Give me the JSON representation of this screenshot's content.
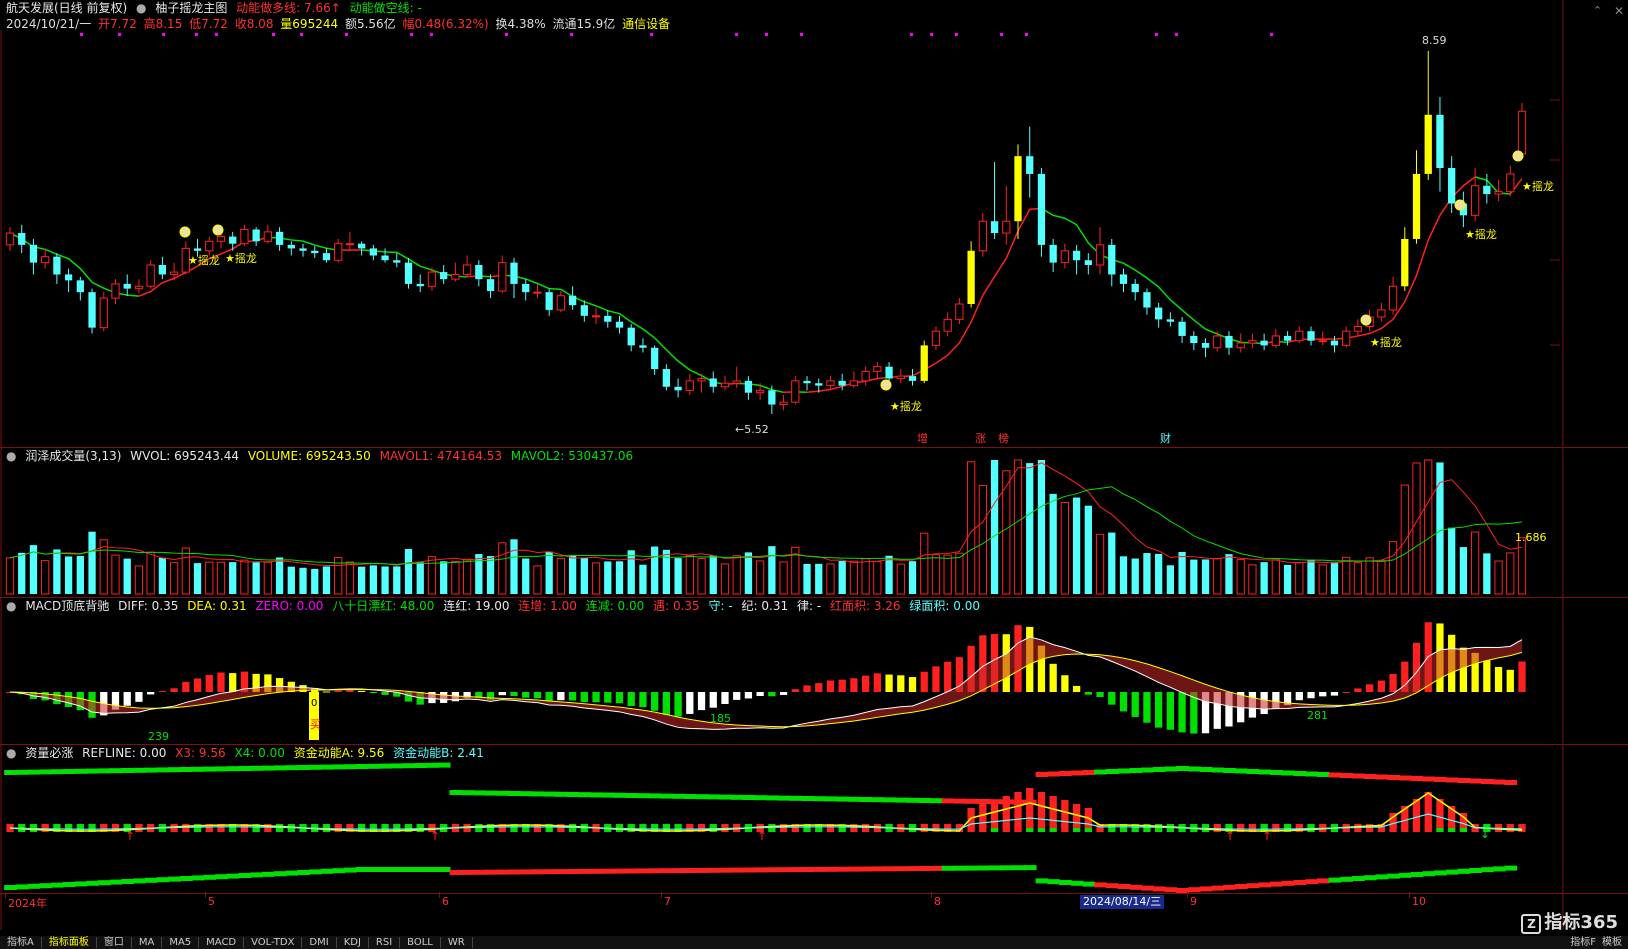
{
  "title_bar": {
    "stock": "航天发展(日线 前复权)",
    "indicator": "柚子摇龙主图",
    "line_bull_label": "动能做多线: 7.66",
    "line_bull_arrow": "↑",
    "line_bear_label": "动能做空线: -"
  },
  "quote_bar": {
    "date": "2024/10/21/一",
    "open": "开7.72",
    "high": "高8.15",
    "low": "低7.72",
    "close": "收8.08",
    "volume": "量695244",
    "amount": "额5.56亿",
    "change": "幅0.48(6.32%)",
    "turnover": "换4.38%",
    "float": "流通15.9亿",
    "sector": "通信设备"
  },
  "main_annotations": {
    "high_price": "8.59",
    "low_price": "5.52",
    "signal_label": "★摇龙",
    "tags": [
      "增",
      "涨",
      "榜",
      "财"
    ]
  },
  "vol_header": {
    "name": "润泽成交量(3,13)",
    "wvol": "WVOL: 695243.44",
    "volume": "VOLUME: 695243.50",
    "mavol1": "MAVOL1: 474164.53",
    "mavol2": "MAVOL2: 530437.06",
    "right_value": "1.686"
  },
  "macd_header": {
    "name": "MACD顶底背驰",
    "diff": "DIFF: 0.35",
    "dea": "DEA: 0.31",
    "zero": "ZERO: 0.00",
    "piao": "八十日漂红: 48.00",
    "lianhong": "连红: 19.00",
    "lianzeng": "连增: 1.00",
    "lianjian": "连减: 0.00",
    "ji": "遇: 0.35",
    "shou": "守: -",
    "ji2": "纪: 0.31",
    "lv": "律: -",
    "hongmianji": "红面积: 3.26",
    "lvmianji": "绿面积: 0.00",
    "labels": [
      "239",
      "185",
      "281"
    ],
    "buy_label": "买",
    "zero_mark": "0"
  },
  "fund_header": {
    "name": "资量必涨",
    "refline": "REFLINE: 0.00",
    "x3": "X3: 9.56",
    "x4": "X4: 0.00",
    "a": "资金动能A: 9.56",
    "b": "资金动能B: 2.41"
  },
  "time_axis": {
    "labels": [
      "2024年",
      "5",
      "6",
      "7",
      "8",
      "9",
      "10"
    ],
    "cursor_date": "2024/08/14/三"
  },
  "bottom_tabs": [
    "指标A",
    "指标面板",
    "窗口",
    "MA",
    "MA5",
    "MACD",
    "VOL-TDX",
    "DMI",
    "KDJ",
    "RSI",
    "BOLL",
    "WR"
  ],
  "bottom_right": [
    "指标F",
    "模板"
  ],
  "brand": "指标365",
  "colors": {
    "up": "#ff2020",
    "down": "#54ffff",
    "yellow": "#ffff00",
    "green": "#00e000",
    "magenta": "#ff00ff",
    "border": "#7a1010"
  },
  "chart_data": {
    "type": "candlestick",
    "price_range": [
      5.52,
      8.59
    ],
    "candles": [
      [
        6.95,
        7.05,
        7.1,
        6.9
      ],
      [
        7.05,
        6.95,
        7.12,
        6.88
      ],
      [
        6.95,
        6.8,
        7.0,
        6.7
      ],
      [
        6.8,
        6.85,
        6.92,
        6.75
      ],
      [
        6.85,
        6.7,
        6.88,
        6.62
      ],
      [
        6.7,
        6.65,
        6.75,
        6.55
      ],
      [
        6.65,
        6.55,
        6.68,
        6.48
      ],
      [
        6.55,
        6.25,
        6.58,
        6.2
      ],
      [
        6.25,
        6.5,
        6.55,
        6.22
      ],
      [
        6.5,
        6.62,
        6.66,
        6.45
      ],
      [
        6.62,
        6.58,
        6.7,
        6.52
      ],
      [
        6.58,
        6.6,
        6.66,
        6.54
      ],
      [
        6.6,
        6.78,
        6.82,
        6.58
      ],
      [
        6.78,
        6.7,
        6.85,
        6.66
      ],
      [
        6.7,
        6.72,
        6.8,
        6.65
      ],
      [
        6.72,
        6.92,
        6.98,
        6.7
      ],
      [
        6.92,
        6.9,
        7.0,
        6.85
      ],
      [
        6.9,
        6.98,
        7.02,
        6.86
      ],
      [
        6.98,
        7.02,
        7.08,
        6.92
      ],
      [
        7.02,
        6.96,
        7.06,
        6.9
      ],
      [
        6.96,
        7.08,
        7.12,
        6.94
      ],
      [
        7.08,
        6.98,
        7.1,
        6.94
      ],
      [
        6.98,
        7.06,
        7.12,
        6.96
      ],
      [
        7.06,
        6.95,
        7.1,
        6.9
      ],
      [
        6.95,
        6.92,
        6.98,
        6.86
      ],
      [
        6.92,
        6.9,
        6.96,
        6.85
      ],
      [
        6.9,
        6.88,
        6.94,
        6.84
      ],
      [
        6.88,
        6.82,
        6.92,
        6.8
      ],
      [
        6.82,
        6.96,
        7.0,
        6.8
      ],
      [
        6.96,
        6.96,
        7.06,
        6.9
      ],
      [
        6.96,
        6.92,
        6.98,
        6.86
      ],
      [
        6.92,
        6.86,
        6.95,
        6.82
      ],
      [
        6.86,
        6.82,
        6.92,
        6.8
      ],
      [
        6.82,
        6.8,
        6.88,
        6.76
      ],
      [
        6.8,
        6.62,
        6.84,
        6.58
      ],
      [
        6.62,
        6.6,
        6.7,
        6.55
      ],
      [
        6.6,
        6.72,
        6.76,
        6.56
      ],
      [
        6.72,
        6.66,
        6.78,
        6.62
      ],
      [
        6.66,
        6.7,
        6.8,
        6.64
      ],
      [
        6.7,
        6.78,
        6.86,
        6.68
      ],
      [
        6.78,
        6.66,
        6.82,
        6.6
      ],
      [
        6.66,
        6.56,
        6.7,
        6.5
      ],
      [
        6.56,
        6.8,
        6.86,
        6.54
      ],
      [
        6.8,
        6.62,
        6.84,
        6.5
      ],
      [
        6.62,
        6.55,
        6.66,
        6.48
      ],
      [
        6.55,
        6.55,
        6.62,
        6.5
      ],
      [
        6.55,
        6.4,
        6.58,
        6.35
      ],
      [
        6.4,
        6.52,
        6.56,
        6.38
      ],
      [
        6.52,
        6.44,
        6.6,
        6.4
      ],
      [
        6.44,
        6.35,
        6.48,
        6.3
      ],
      [
        6.35,
        6.35,
        6.42,
        6.28
      ],
      [
        6.35,
        6.3,
        6.4,
        6.25
      ],
      [
        6.3,
        6.25,
        6.35,
        6.2
      ],
      [
        6.25,
        6.1,
        6.28,
        6.05
      ],
      [
        6.1,
        6.08,
        6.16,
        6.04
      ],
      [
        6.08,
        5.9,
        6.1,
        5.85
      ],
      [
        5.9,
        5.75,
        5.94,
        5.72
      ],
      [
        5.75,
        5.72,
        5.82,
        5.66
      ],
      [
        5.72,
        5.8,
        5.86,
        5.68
      ],
      [
        5.8,
        5.82,
        5.86,
        5.7
      ],
      [
        5.82,
        5.75,
        5.88,
        5.7
      ],
      [
        5.75,
        5.78,
        5.84,
        5.72
      ],
      [
        5.78,
        5.8,
        5.92,
        5.74
      ],
      [
        5.8,
        5.7,
        5.84,
        5.64
      ],
      [
        5.7,
        5.72,
        5.78,
        5.64
      ],
      [
        5.72,
        5.6,
        5.76,
        5.52
      ],
      [
        5.6,
        5.62,
        5.68,
        5.55
      ],
      [
        5.62,
        5.8,
        5.84,
        5.6
      ],
      [
        5.8,
        5.78,
        5.84,
        5.72
      ],
      [
        5.78,
        5.76,
        5.82,
        5.7
      ],
      [
        5.76,
        5.8,
        5.84,
        5.72
      ],
      [
        5.8,
        5.76,
        5.86,
        5.72
      ],
      [
        5.76,
        5.8,
        5.88,
        5.74
      ],
      [
        5.8,
        5.88,
        5.92,
        5.76
      ],
      [
        5.88,
        5.92,
        5.96,
        5.82
      ],
      [
        5.92,
        5.82,
        5.96,
        5.78
      ],
      [
        5.82,
        5.84,
        5.9,
        5.78
      ],
      [
        5.84,
        5.8,
        5.9,
        5.76
      ],
      [
        5.8,
        6.1,
        6.14,
        5.78
      ],
      [
        6.1,
        6.22,
        6.26,
        6.06
      ],
      [
        6.22,
        6.32,
        6.38,
        6.18
      ],
      [
        6.32,
        6.45,
        6.5,
        6.28
      ],
      [
        6.45,
        6.9,
        6.98,
        6.42
      ],
      [
        6.9,
        7.15,
        7.22,
        6.85
      ],
      [
        7.15,
        7.05,
        7.65,
        7.0
      ],
      [
        7.05,
        7.15,
        7.45,
        6.95
      ],
      [
        7.15,
        7.7,
        7.8,
        7.0
      ],
      [
        7.7,
        7.55,
        7.95,
        7.35
      ],
      [
        7.55,
        6.95,
        7.6,
        6.85
      ],
      [
        6.95,
        6.8,
        7.0,
        6.72
      ],
      [
        6.8,
        6.9,
        6.96,
        6.75
      ],
      [
        6.9,
        6.82,
        6.95,
        6.7
      ],
      [
        6.82,
        6.78,
        6.88,
        6.7
      ],
      [
        6.78,
        6.95,
        7.1,
        6.7
      ],
      [
        6.95,
        6.7,
        7.0,
        6.6
      ],
      [
        6.7,
        6.62,
        6.75,
        6.55
      ],
      [
        6.62,
        6.55,
        6.66,
        6.48
      ],
      [
        6.55,
        6.42,
        6.58,
        6.36
      ],
      [
        6.42,
        6.32,
        6.46,
        6.25
      ],
      [
        6.32,
        6.3,
        6.38,
        6.26
      ],
      [
        6.3,
        6.18,
        6.34,
        6.12
      ],
      [
        6.18,
        6.12,
        6.22,
        6.06
      ],
      [
        6.12,
        6.08,
        6.16,
        6.0
      ],
      [
        6.08,
        6.18,
        6.22,
        6.05
      ],
      [
        6.18,
        6.08,
        6.22,
        6.02
      ],
      [
        6.08,
        6.12,
        6.2,
        6.04
      ],
      [
        6.12,
        6.14,
        6.2,
        6.08
      ],
      [
        6.14,
        6.1,
        6.2,
        6.06
      ],
      [
        6.1,
        6.18,
        6.24,
        6.08
      ],
      [
        6.18,
        6.14,
        6.22,
        6.1
      ],
      [
        6.14,
        6.22,
        6.26,
        6.12
      ],
      [
        6.22,
        6.14,
        6.26,
        6.1
      ],
      [
        6.14,
        6.14,
        6.22,
        6.1
      ],
      [
        6.14,
        6.1,
        6.18,
        6.04
      ],
      [
        6.1,
        6.22,
        6.26,
        6.08
      ],
      [
        6.22,
        6.26,
        6.32,
        6.18
      ],
      [
        6.26,
        6.34,
        6.4,
        6.22
      ],
      [
        6.34,
        6.4,
        6.46,
        6.3
      ],
      [
        6.4,
        6.6,
        6.68,
        6.36
      ],
      [
        6.6,
        7.0,
        7.1,
        6.56
      ],
      [
        7.0,
        7.55,
        7.75,
        6.96
      ],
      [
        7.55,
        8.05,
        8.59,
        7.5
      ],
      [
        8.05,
        7.6,
        8.2,
        7.4
      ],
      [
        7.6,
        7.3,
        7.7,
        7.22
      ],
      [
        7.3,
        7.2,
        7.4,
        7.1
      ],
      [
        7.2,
        7.45,
        7.6,
        7.15
      ],
      [
        7.45,
        7.38,
        7.55,
        7.3
      ],
      [
        7.38,
        7.4,
        7.5,
        7.32
      ],
      [
        7.4,
        7.55,
        7.62,
        7.36
      ],
      [
        7.72,
        8.08,
        8.15,
        7.72
      ]
    ]
  }
}
